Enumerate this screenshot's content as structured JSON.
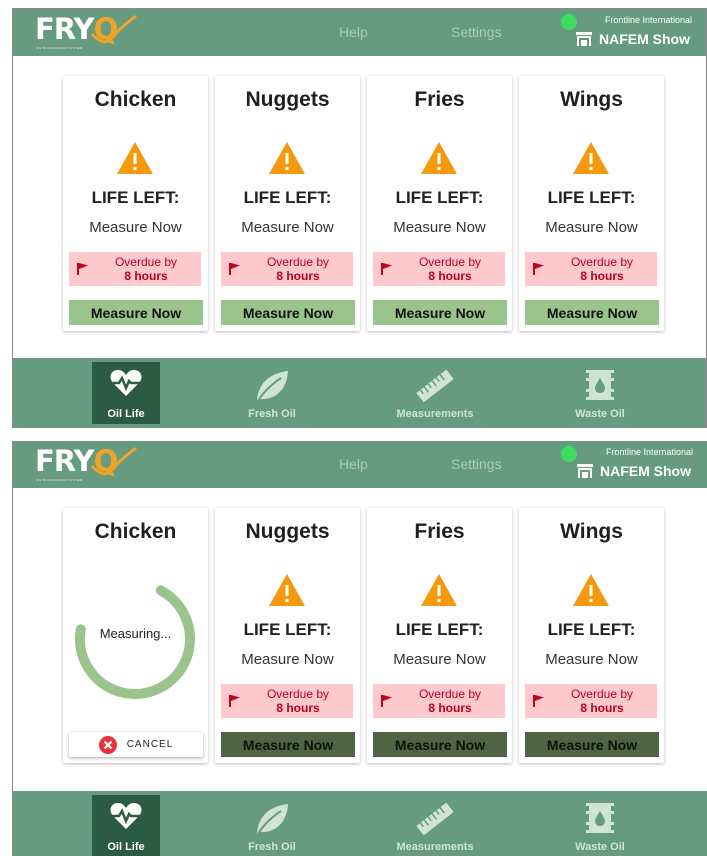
{
  "header": {
    "logo_text_main": "FRY",
    "logo_text_accent": "Q",
    "logo_tagline": "OIL MANAGEMENT SYSTEM",
    "nav_links": [
      "Help",
      "Settings"
    ],
    "status_color": "#3ddc5b",
    "org_name": "Frontline International",
    "store_icon": "store-icon",
    "store_name": "NAFEM Show"
  },
  "colors": {
    "header_bg": "#679b7f",
    "nav_active_bg": "#2b5a45",
    "measure_btn": "#9bc48c",
    "measure_btn_disabled": "#4e6444",
    "overdue_bg": "#fec9cc",
    "overdue_text": "#b4001a",
    "warning": "#f59a0b",
    "ring": "#9bc48c"
  },
  "screens": [
    {
      "cards": [
        {
          "title": "Chicken",
          "icon": "warning-icon",
          "life_label": "LIFE LEFT:",
          "life_value": "Measure Now",
          "overdue_label": "Overdue by",
          "overdue_value": "8 hours",
          "button": "Measure Now"
        },
        {
          "title": "Nuggets",
          "icon": "warning-icon",
          "life_label": "LIFE LEFT:",
          "life_value": "Measure Now",
          "overdue_label": "Overdue by",
          "overdue_value": "8 hours",
          "button": "Measure Now"
        },
        {
          "title": "Fries",
          "icon": "warning-icon",
          "life_label": "LIFE LEFT:",
          "life_value": "Measure Now",
          "overdue_label": "Overdue by",
          "overdue_value": "8 hours",
          "button": "Measure Now"
        },
        {
          "title": "Wings",
          "icon": "warning-icon",
          "life_label": "LIFE LEFT:",
          "life_value": "Measure Now",
          "overdue_label": "Overdue by",
          "overdue_value": "8 hours",
          "button": "Measure Now"
        }
      ]
    },
    {
      "cards": [
        {
          "title": "Chicken",
          "measuring_text": "Measuring...",
          "progress_fraction": 0.7,
          "cancel_label": "CANCEL",
          "cancel_icon": "close-circle-icon"
        },
        {
          "title": "Nuggets",
          "icon": "warning-icon",
          "life_label": "LIFE LEFT:",
          "life_value": "Measure Now",
          "overdue_label": "Overdue by",
          "overdue_value": "8 hours",
          "button": "Measure Now",
          "button_disabled": true
        },
        {
          "title": "Fries",
          "icon": "warning-icon",
          "life_label": "LIFE LEFT:",
          "life_value": "Measure Now",
          "overdue_label": "Overdue by",
          "overdue_value": "8 hours",
          "button": "Measure Now",
          "button_disabled": true
        },
        {
          "title": "Wings",
          "icon": "warning-icon",
          "life_label": "LIFE LEFT:",
          "life_value": "Measure Now",
          "overdue_label": "Overdue by",
          "overdue_value": "8 hours",
          "button": "Measure Now",
          "button_disabled": true
        }
      ]
    }
  ],
  "bottom_nav": [
    {
      "label": "Oil Life",
      "icon": "heartbeat-icon",
      "active": true
    },
    {
      "label": "Fresh Oil",
      "icon": "leaf-icon",
      "active": false
    },
    {
      "label": "Measurements",
      "icon": "ruler-icon",
      "active": false
    },
    {
      "label": "Waste Oil",
      "icon": "oil-barrel-icon",
      "active": false
    }
  ]
}
